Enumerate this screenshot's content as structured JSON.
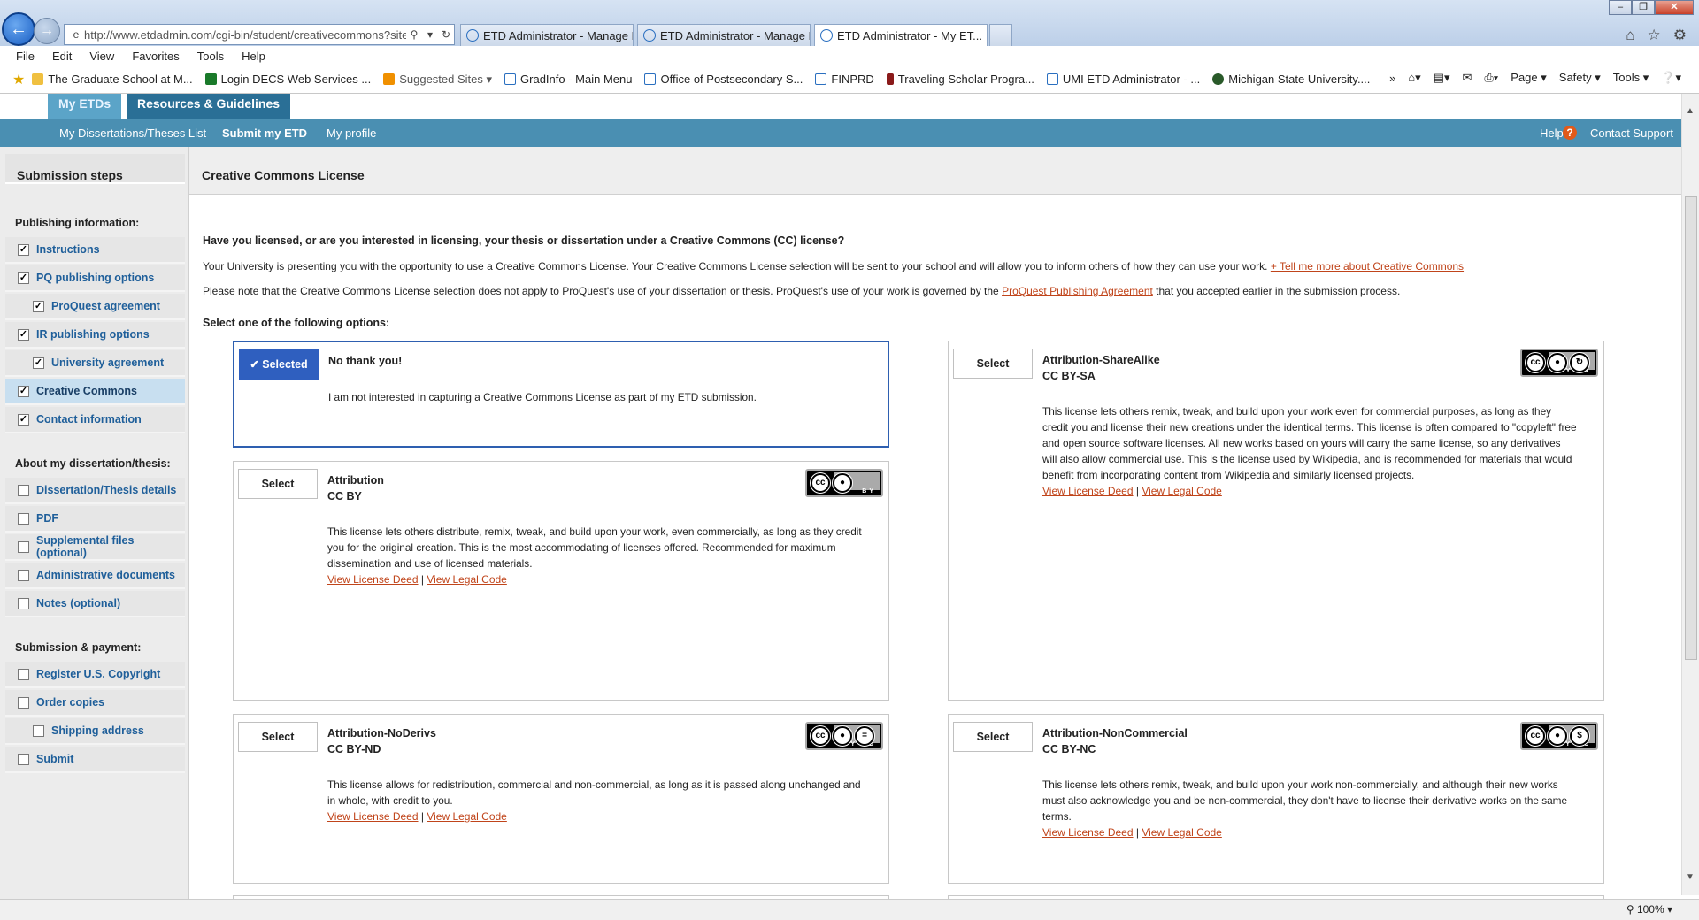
{
  "browser": {
    "address_url": "http://www.etdadmin.com/cgi-bin/student/creativecommons?siteId",
    "address_domain": "etdadmin.com",
    "tabs": [
      {
        "label": "ETD Administrator - Manage D..."
      },
      {
        "label": "ETD Administrator - Manage D..."
      },
      {
        "label": "ETD Administrator - My ET..."
      }
    ],
    "menu": [
      "File",
      "Edit",
      "View",
      "Favorites",
      "Tools",
      "Help"
    ],
    "favorites": [
      "The Graduate School at M...",
      "Login DECS Web Services ...",
      "Suggested Sites ▾",
      "GradInfo - Main Menu",
      "Office of Postsecondary S...",
      "FINPRD",
      "Traveling Scholar Progra...",
      "UMI ETD Administrator - ...",
      "Michigan State University...."
    ],
    "command_bar": [
      "Page ▾",
      "Safety ▾",
      "Tools ▾"
    ],
    "zoom": "100%"
  },
  "site": {
    "tabs": {
      "my_etds": "My ETDs",
      "resources": "Resources & Guidelines"
    },
    "nav": {
      "list": "My Dissertations/Theses List",
      "submit": "Submit my ETD",
      "profile": "My profile",
      "help": "Help",
      "contact": "Contact Support"
    }
  },
  "sidebar": {
    "title": "Submission steps",
    "sections": {
      "publishing": "Publishing information:",
      "about": "About my dissertation/thesis:",
      "payment": "Submission & payment:"
    },
    "items": [
      {
        "label": "Instructions",
        "checked": true
      },
      {
        "label": "PQ publishing options",
        "checked": true
      },
      {
        "label": "ProQuest agreement",
        "checked": true
      },
      {
        "label": "IR publishing options",
        "checked": true
      },
      {
        "label": "University agreement",
        "checked": true
      },
      {
        "label": "Creative Commons",
        "checked": true
      },
      {
        "label": "Contact information",
        "checked": true
      },
      {
        "label": "Dissertation/Thesis details",
        "checked": false
      },
      {
        "label": "PDF",
        "checked": false
      },
      {
        "label": "Supplemental files (optional)",
        "checked": false
      },
      {
        "label": "Administrative documents",
        "checked": false
      },
      {
        "label": "Notes (optional)",
        "checked": false
      },
      {
        "label": "Register U.S. Copyright",
        "checked": false
      },
      {
        "label": "Order copies",
        "checked": false
      },
      {
        "label": "Shipping address",
        "checked": false
      },
      {
        "label": "Submit",
        "checked": false
      }
    ]
  },
  "main": {
    "title": "Creative Commons License",
    "question": "Have you licensed, or are you interested in licensing, your thesis or dissertation under a Creative Commons (CC) license?",
    "intro1": "Your University is presenting you with the opportunity to use a Creative Commons License. Your Creative Commons License selection will be sent to your school and will allow you to inform others of how they can use your work.",
    "intro1_link": "+ Tell me more about Creative Commons",
    "intro2_a": "Please note that the Creative Commons License selection does not apply to ProQuest's use of your dissertation or thesis. ProQuest's use of your work is governed by the",
    "intro2_link": "ProQuest Publishing Agreement",
    "intro2_b": "that you accepted earlier in the submission process.",
    "select_prompt": "Select one of the following options:",
    "select_label": "Select",
    "selected_label": "✔  Selected",
    "view_deed": "View License Deed",
    "view_code": "View Legal Code",
    "separator": "|",
    "options": {
      "none": {
        "name": "No thank you!",
        "desc": "I am not interested in capturing a Creative Commons License as part of my ETD submission."
      },
      "by": {
        "name": "Attribution",
        "code": "CC BY",
        "desc": "This license lets others distribute, remix, tweak, and build upon your work, even commercially, as long as they credit you for the original creation. This is the most accommodating of licenses offered. Recommended for maximum dissemination and use of licensed materials.",
        "badge": "BY"
      },
      "by_sa": {
        "name": "Attribution-ShareAlike",
        "code": "CC BY-SA",
        "desc": "This license lets others remix, tweak, and build upon your work even for commercial purposes, as long as they credit you and license their new creations under the identical terms. This license is often compared to \"copyleft\" free and open source software licenses. All new works based on yours will carry the same license, so any derivatives will also allow commercial use. This is the license used by Wikipedia, and is recommended for materials that would benefit from incorporating content from Wikipedia and similarly licensed projects.",
        "badge": "BY SA"
      },
      "by_nd": {
        "name": "Attribution-NoDerivs",
        "code": "CC BY-ND",
        "desc": "This license allows for redistribution, commercial and non-commercial, as long as it is passed along unchanged and in whole, with credit to you.",
        "badge": "BY ND"
      },
      "by_nc": {
        "name": "Attribution-NonCommercial",
        "code": "CC BY-NC",
        "desc": "This license lets others remix, tweak, and build upon your work non-commercially, and although their new works must also acknowledge you and be non-commercial, they don't have to license their derivative works on the same terms.",
        "badge": "BY NC"
      }
    }
  }
}
